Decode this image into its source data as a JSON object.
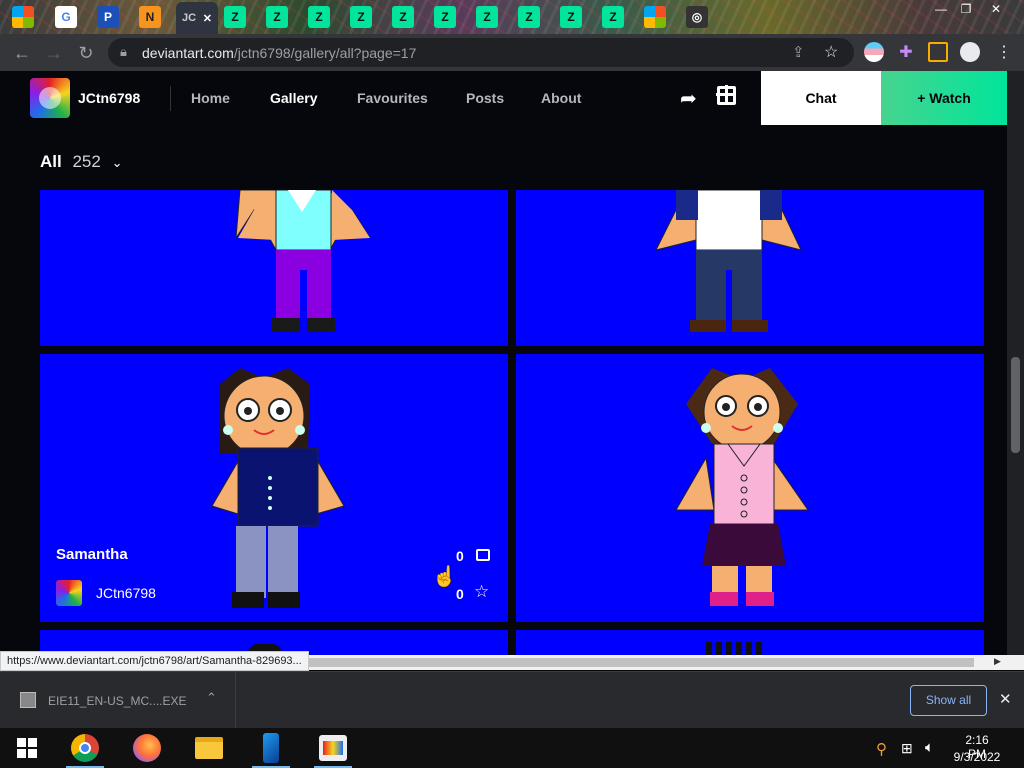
{
  "browser": {
    "active_tab_label": "JC",
    "tab_icons": [
      "tab-icon-windows",
      "tab-icon-google",
      "tab-icon-pa",
      "tab-icon-ng",
      "tab-icon-deviantart"
    ],
    "url_host": "deviantart.com",
    "url_path": "/jctn6798/gallery/all?page=17",
    "status_url": "https://www.deviantart.com/jctn6798/art/Samantha-829693..."
  },
  "header": {
    "username": "JCtn6798",
    "nav": [
      "Home",
      "Gallery",
      "Favourites",
      "Posts",
      "About"
    ],
    "active_nav": "Gallery",
    "chat_label": "Chat",
    "watch_label": "+ Watch"
  },
  "gallery": {
    "filter_label": "All",
    "count": "252",
    "hovered_item": {
      "title": "Samantha",
      "author": "JCtn6798",
      "comments": "0",
      "favourites": "0"
    }
  },
  "downloads": {
    "file_name": "EIE11_EN-US_MC....EXE",
    "show_all_label": "Show all"
  },
  "taskbar": {
    "time": "2:16 PM",
    "date": "9/3/2022"
  },
  "colors": {
    "thumb_bg": "#0000fe",
    "watch_accent": "#00e59b",
    "page_bg": "#06070d"
  }
}
